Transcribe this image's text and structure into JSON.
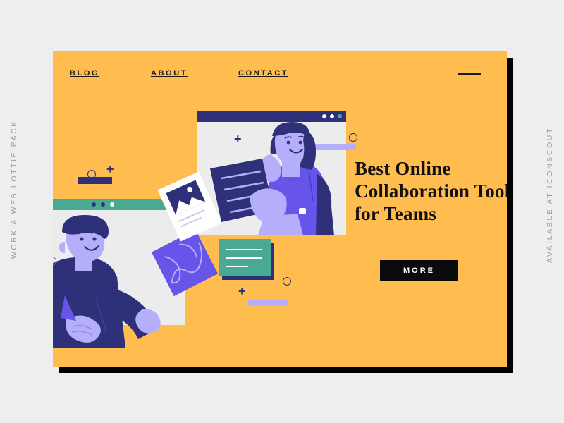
{
  "page": {
    "background_color": "#eeeeee",
    "hero_color": "#ffbc4f",
    "shadow_color": "#000000",
    "accent_navy": "#2e3179",
    "accent_purple": "#6655e8",
    "accent_light_purple": "#b4aefb",
    "accent_teal": "#4aa992",
    "text_dark": "#111111"
  },
  "side_captions": {
    "left": "WORK & WEB LOTTIE PACK",
    "right": "AVAILABLE AT ICONSCOUT"
  },
  "nav": {
    "items": [
      {
        "label": "BLOG"
      },
      {
        "label": "ABOUT"
      },
      {
        "label": "CONTACT"
      }
    ],
    "menu_icon": "menu-line-icon"
  },
  "hero": {
    "headline": "Best Online Collaboration Tools for Teams",
    "cta_label": "MORE"
  },
  "illustration": {
    "window_top": {
      "title_bar_color": "#2e3179",
      "dots": [
        "white",
        "white",
        "green"
      ]
    },
    "window_left": {
      "title_bar_color": "#4aa992",
      "dots": [
        "navy",
        "navy",
        "white"
      ]
    },
    "photo_card_icon": "image-mountain-icon",
    "green_card_lines": 3,
    "characters": [
      {
        "name": "woman-reading-documents"
      },
      {
        "name": "man-holding-card"
      }
    ],
    "decorations": [
      "plus-icon",
      "plus-icon",
      "plus-icon",
      "circle-outline",
      "circle-outline",
      "circle-outline",
      "purple-bar",
      "purple-bar",
      "navy-bar",
      "vertical-line"
    ]
  }
}
